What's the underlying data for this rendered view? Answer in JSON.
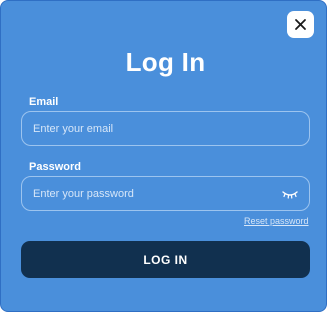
{
  "dialog": {
    "title": "Log In",
    "close_icon": "close-icon"
  },
  "email": {
    "label": "Email",
    "placeholder": "Enter your email",
    "value": ""
  },
  "password": {
    "label": "Password",
    "placeholder": "Enter your password",
    "value": "",
    "toggle_icon": "eye-closed-icon"
  },
  "reset_link": "Reset password",
  "submit_label": "LOG IN",
  "colors": {
    "modal_background": "#4a8fdb",
    "button_background": "#11304f",
    "text": "#ffffff"
  }
}
